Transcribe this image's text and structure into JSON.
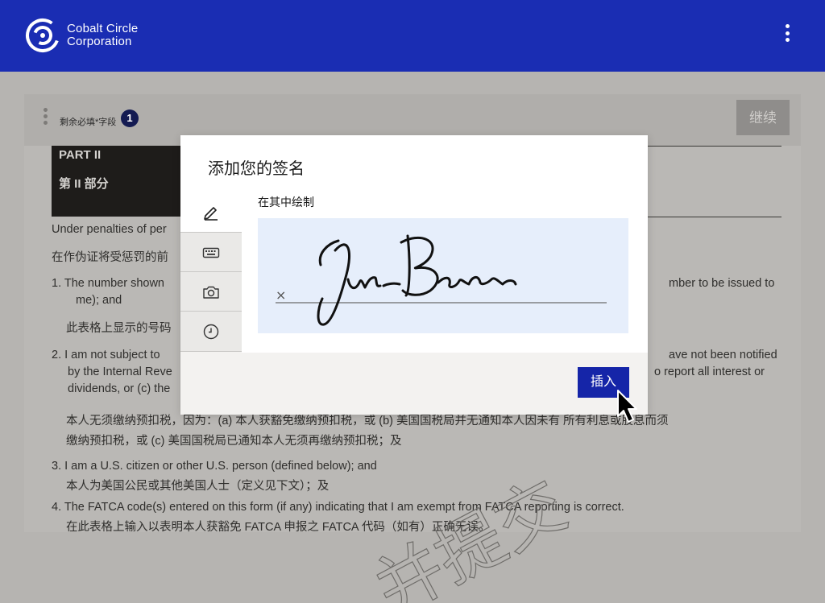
{
  "header": {
    "brand_line1": "Cobalt Circle",
    "brand_line2": "Corporation",
    "logo_icon": "cobalt-circle-logo",
    "menu_icon": "kebab-menu-icon",
    "bg_color": "#1a2db3"
  },
  "toolbar": {
    "remaining_label": "剩余必填*字段",
    "remaining_count": "1",
    "continue_label": "继续"
  },
  "document": {
    "part_en": "PART II",
    "part_zh": "第 II 部分",
    "lines": [
      "Under penalties of per",
      "在作伪证将受惩罚的前",
      "1.  The number shown",
      "mber to be issued to",
      "me); and",
      "此表格上显示的号码",
      "2.  I am not subject to",
      "ave not been notified",
      "by the Internal Reve",
      "o report all interest or",
      "dividends, or (c) the",
      "本人无须缴纳预扣税，因为：(a) 本人获豁免缴纳预扣税，或 (b) 美国国税局并无通知本人因未有                   所有利息或股息而须",
      "缴纳预扣税，或 (c) 美国国税局已通知本人无须再缴纳预扣税；及",
      "3.  I am a U.S. citizen or other U.S. person (defined below); and",
      "本人为美国公民或其他美国人士（定义见下文）；及",
      "4.  The FATCA code(s) entered on this form (if any) indicating that I am exempt from FATCA reporting is correct.",
      "在此表格上输入以表明本人获豁免 FATCA 申报之 FATCA 代码（如有）正确无误。"
    ],
    "watermark": "并提交"
  },
  "modal": {
    "title": "添加您的签名",
    "tabs": [
      {
        "name": "draw",
        "icon": "pencil-icon"
      },
      {
        "name": "type",
        "icon": "keyboard-icon"
      },
      {
        "name": "camera",
        "icon": "camera-icon"
      },
      {
        "name": "history",
        "icon": "clock-icon"
      }
    ],
    "draw_label": "在其中绘制",
    "signature_mark": "×",
    "insert_label": "插入",
    "accent_color": "#1525a8"
  }
}
